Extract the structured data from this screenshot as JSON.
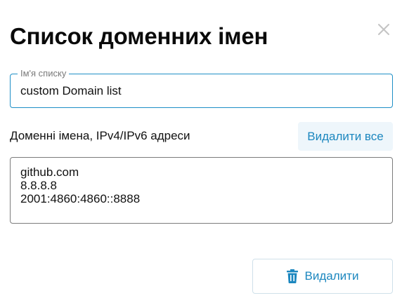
{
  "dialog": {
    "title": "Список доменних імен"
  },
  "name_field": {
    "label": "Ім'я списку",
    "value": "custom Domain list"
  },
  "domains": {
    "label": "Доменні імена, IPv4/IPv6 адреси",
    "delete_all_label": "Видалити все",
    "entries": [
      "github.com",
      "8.8.8.8",
      "2001:4860:4860::8888"
    ]
  },
  "footer": {
    "delete_label": "Видалити"
  },
  "icons": {
    "close": "close-icon",
    "delete": "trash-icon"
  },
  "colors": {
    "accent": "#1c87bf",
    "focus_border": "#1e8fc6",
    "close_icon": "#c4c4c4"
  }
}
